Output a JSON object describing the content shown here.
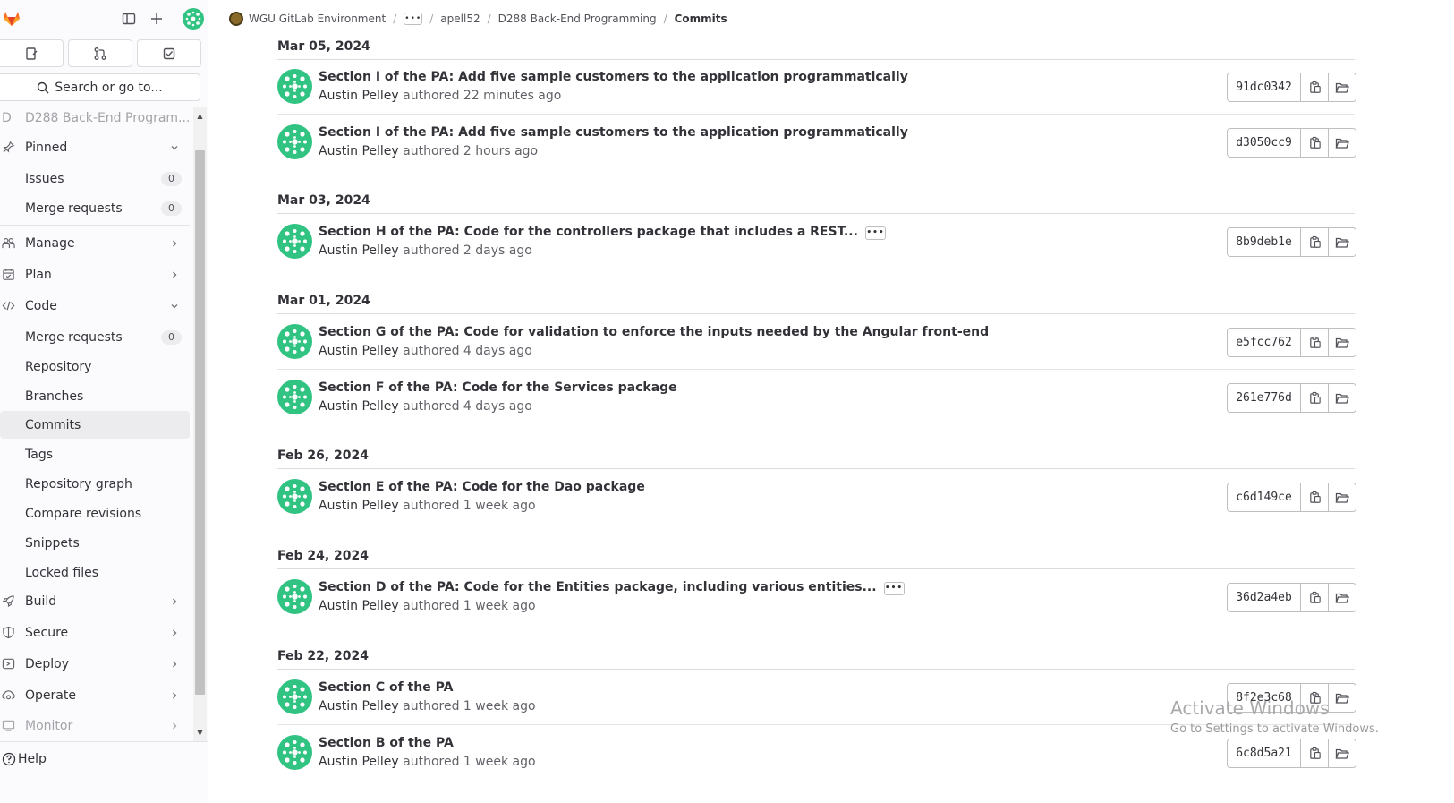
{
  "sidebar": {
    "search_label": "Search or go to...",
    "project_initial": "D",
    "project_name": "D288 Back-End Program...",
    "sections": {
      "pinned": "Pinned",
      "manage": "Manage",
      "plan": "Plan",
      "code": "Code",
      "build": "Build",
      "secure": "Secure",
      "deploy": "Deploy",
      "operate": "Operate",
      "monitor": "Monitor"
    },
    "pinned_items": [
      {
        "label": "Issues",
        "count": "0"
      },
      {
        "label": "Merge requests",
        "count": "0"
      }
    ],
    "code_items": [
      {
        "label": "Merge requests",
        "count": "0"
      },
      {
        "label": "Repository"
      },
      {
        "label": "Branches"
      },
      {
        "label": "Commits"
      },
      {
        "label": "Tags"
      },
      {
        "label": "Repository graph"
      },
      {
        "label": "Compare revisions"
      },
      {
        "label": "Snippets"
      },
      {
        "label": "Locked files"
      }
    ],
    "help_label": "Help"
  },
  "breadcrumb": {
    "group": "WGU GitLab Environment",
    "user": "apell52",
    "project": "D288 Back-End Programming",
    "current": "Commits"
  },
  "commits_page": {
    "days": [
      {
        "date": "Mar 05, 2024",
        "commits": [
          {
            "title": "Section I of the PA: Add five sample customers to the application programmatically",
            "author": "Austin Pelley",
            "verb": "authored",
            "time": "22 minutes ago",
            "sha": "91dc0342"
          },
          {
            "title": "Section I of the PA: Add five sample customers to the application programmatically",
            "author": "Austin Pelley",
            "verb": "authored",
            "time": "2 hours ago",
            "sha": "d3050cc9"
          }
        ]
      },
      {
        "date": "Mar 03, 2024",
        "commits": [
          {
            "title": "Section H of the PA: Code for the controllers package that includes a REST...",
            "author": "Austin Pelley",
            "verb": "authored",
            "time": "2 days ago",
            "sha": "8b9deb1e",
            "truncated": true
          }
        ]
      },
      {
        "date": "Mar 01, 2024",
        "commits": [
          {
            "title": "Section G of the PA: Code for validation to enforce the inputs needed by the Angular front-end",
            "author": "Austin Pelley",
            "verb": "authored",
            "time": "4 days ago",
            "sha": "e5fcc762"
          },
          {
            "title": "Section F of the PA: Code for the Services package",
            "author": "Austin Pelley",
            "verb": "authored",
            "time": "4 days ago",
            "sha": "261e776d"
          }
        ]
      },
      {
        "date": "Feb 26, 2024",
        "commits": [
          {
            "title": "Section E of the PA: Code for the Dao package",
            "author": "Austin Pelley",
            "verb": "authored",
            "time": "1 week ago",
            "sha": "c6d149ce"
          }
        ]
      },
      {
        "date": "Feb 24, 2024",
        "commits": [
          {
            "title": "Section D of the PA: Code for the Entities package, including various entities...",
            "author": "Austin Pelley",
            "verb": "authored",
            "time": "1 week ago",
            "sha": "36d2a4eb",
            "truncated": true
          }
        ]
      },
      {
        "date": "Feb 22, 2024",
        "commits": [
          {
            "title": "Section C of the PA",
            "author": "Austin Pelley",
            "verb": "authored",
            "time": "1 week ago",
            "sha": "8f2e3c68"
          },
          {
            "title": "Section B of the PA",
            "author": "Austin Pelley",
            "verb": "authored",
            "time": "1 week ago",
            "sha": "6c8d5a21"
          }
        ]
      }
    ]
  },
  "watermark": {
    "line1": "Activate Windows",
    "line2": "Go to Settings to activate Windows."
  },
  "colors": {
    "avatar_green": "#30c382",
    "sidebar_bg": "#fbfafd",
    "active_item_bg": "#ececef",
    "border": "#bfbfc3"
  }
}
